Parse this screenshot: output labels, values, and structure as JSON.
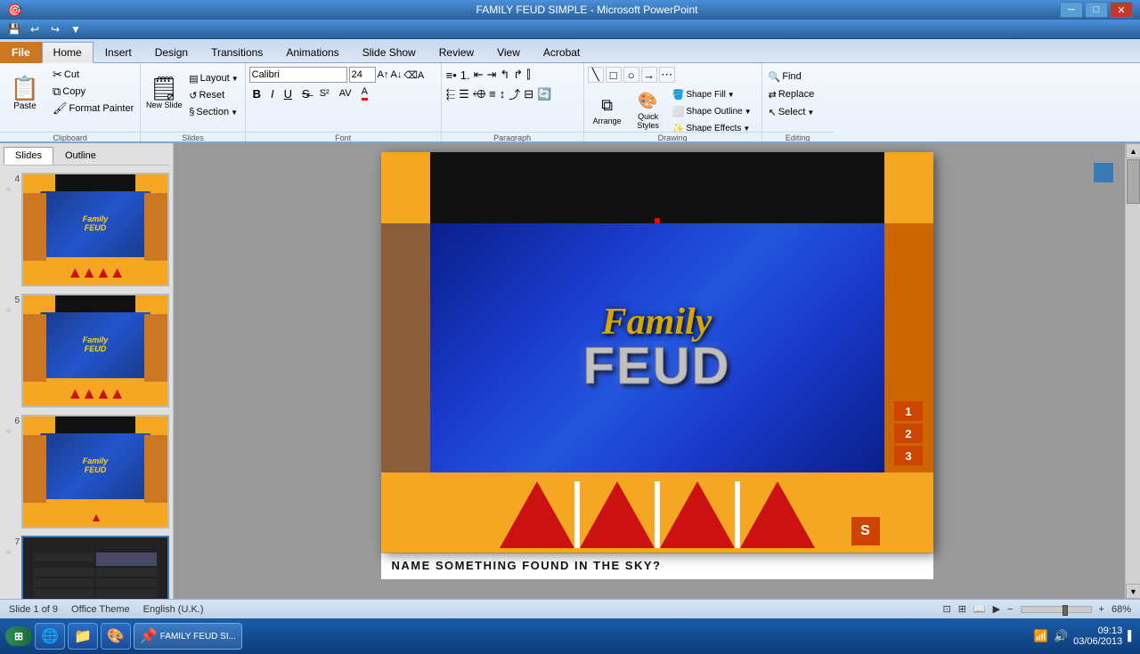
{
  "titlebar": {
    "title": "FAMILY FEUD SIMPLE - Microsoft PowerPoint",
    "controls": [
      "─",
      "□",
      "✕"
    ]
  },
  "qat": {
    "buttons": [
      "💾",
      "↩",
      "↪",
      "▼"
    ]
  },
  "ribbon": {
    "tabs": [
      "File",
      "Home",
      "Insert",
      "Design",
      "Transitions",
      "Animations",
      "Slide Show",
      "Review",
      "View",
      "Acrobat"
    ],
    "active_tab": "Home",
    "groups": {
      "clipboard": {
        "label": "Clipboard",
        "paste_label": "Paste",
        "cut_label": "Cut",
        "copy_label": "Copy",
        "format_painter_label": "Format Painter"
      },
      "slides": {
        "label": "Slides",
        "new_slide_label": "New Slide",
        "layout_label": "Layout",
        "reset_label": "Reset",
        "section_label": "Section"
      },
      "font": {
        "label": "Font",
        "font_name": "Calibri",
        "font_size": "24"
      },
      "paragraph": {
        "label": "Paragraph"
      },
      "drawing": {
        "label": "Drawing"
      },
      "editing": {
        "label": "Editing",
        "find_label": "Find",
        "replace_label": "Replace",
        "select_label": "Select"
      }
    }
  },
  "slide_panel": {
    "tabs": [
      "Slides",
      "Outline"
    ],
    "slides": [
      {
        "num": 4,
        "type": "family_feud"
      },
      {
        "num": 5,
        "type": "family_feud"
      },
      {
        "num": 6,
        "type": "family_feud_small"
      },
      {
        "num": 7,
        "type": "scoreboard"
      }
    ]
  },
  "main_slide": {
    "question": "NAME SOMETHING FOUND IN THE SKY?",
    "score_numbers": [
      "1",
      "2",
      "3"
    ],
    "score_s": "S"
  },
  "statusbar": {
    "slide_info": "Slide 1 of 9",
    "theme": "Office Theme",
    "language": "English (U.K.)",
    "zoom": "68%"
  },
  "taskbar": {
    "time": "09:13",
    "date": "03/06/2013",
    "apps": [
      "⊞",
      "🌐",
      "📁",
      "🎨",
      "📌"
    ]
  }
}
